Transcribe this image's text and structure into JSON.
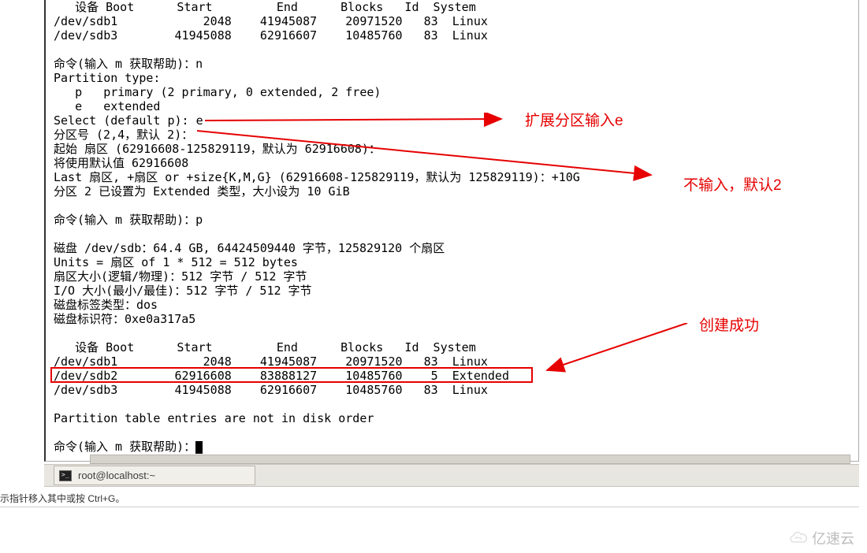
{
  "terminal": {
    "lines": [
      "   设备 Boot      Start         End      Blocks   Id  System",
      "/dev/sdb1            2048    41945087    20971520   83  Linux",
      "/dev/sdb3        41945088    62916607    10485760   83  Linux",
      "",
      "命令(输入 m 获取帮助)：n",
      "Partition type:",
      "   p   primary (2 primary, 0 extended, 2 free)",
      "   e   extended",
      "Select (default p): e",
      "分区号 (2,4，默认 2)：",
      "起始 扇区 (62916608-125829119，默认为 62916608)：",
      "将使用默认值 62916608",
      "Last 扇区, +扇区 or +size{K,M,G} (62916608-125829119，默认为 125829119)：+10G",
      "分区 2 已设置为 Extended 类型，大小设为 10 GiB",
      "",
      "命令(输入 m 获取帮助)：p",
      "",
      "磁盘 /dev/sdb：64.4 GB, 64424509440 字节，125829120 个扇区",
      "Units = 扇区 of 1 * 512 = 512 bytes",
      "扇区大小(逻辑/物理)：512 字节 / 512 字节",
      "I/O 大小(最小/最佳)：512 字节 / 512 字节",
      "磁盘标签类型：dos",
      "磁盘标识符：0xe0a317a5",
      "",
      "   设备 Boot      Start         End      Blocks   Id  System",
      "/dev/sdb1            2048    41945087    20971520   83  Linux",
      "/dev/sdb2        62916608    83888127    10485760    5  Extended",
      "/dev/sdb3        41945088    62916607    10485760   83  Linux",
      "",
      "Partition table entries are not in disk order",
      "",
      "命令(输入 m 获取帮助)："
    ]
  },
  "annotations": {
    "a1": "扩展分区输入e",
    "a2": "不输入，默认2",
    "a3": "创建成功"
  },
  "taskbar": {
    "button_label": "root@localhost:~"
  },
  "statusbar": {
    "text": "示指针移入其中或按 Ctrl+G。"
  },
  "watermark": {
    "text": "亿速云"
  },
  "highlight": {
    "row_index": 26
  }
}
